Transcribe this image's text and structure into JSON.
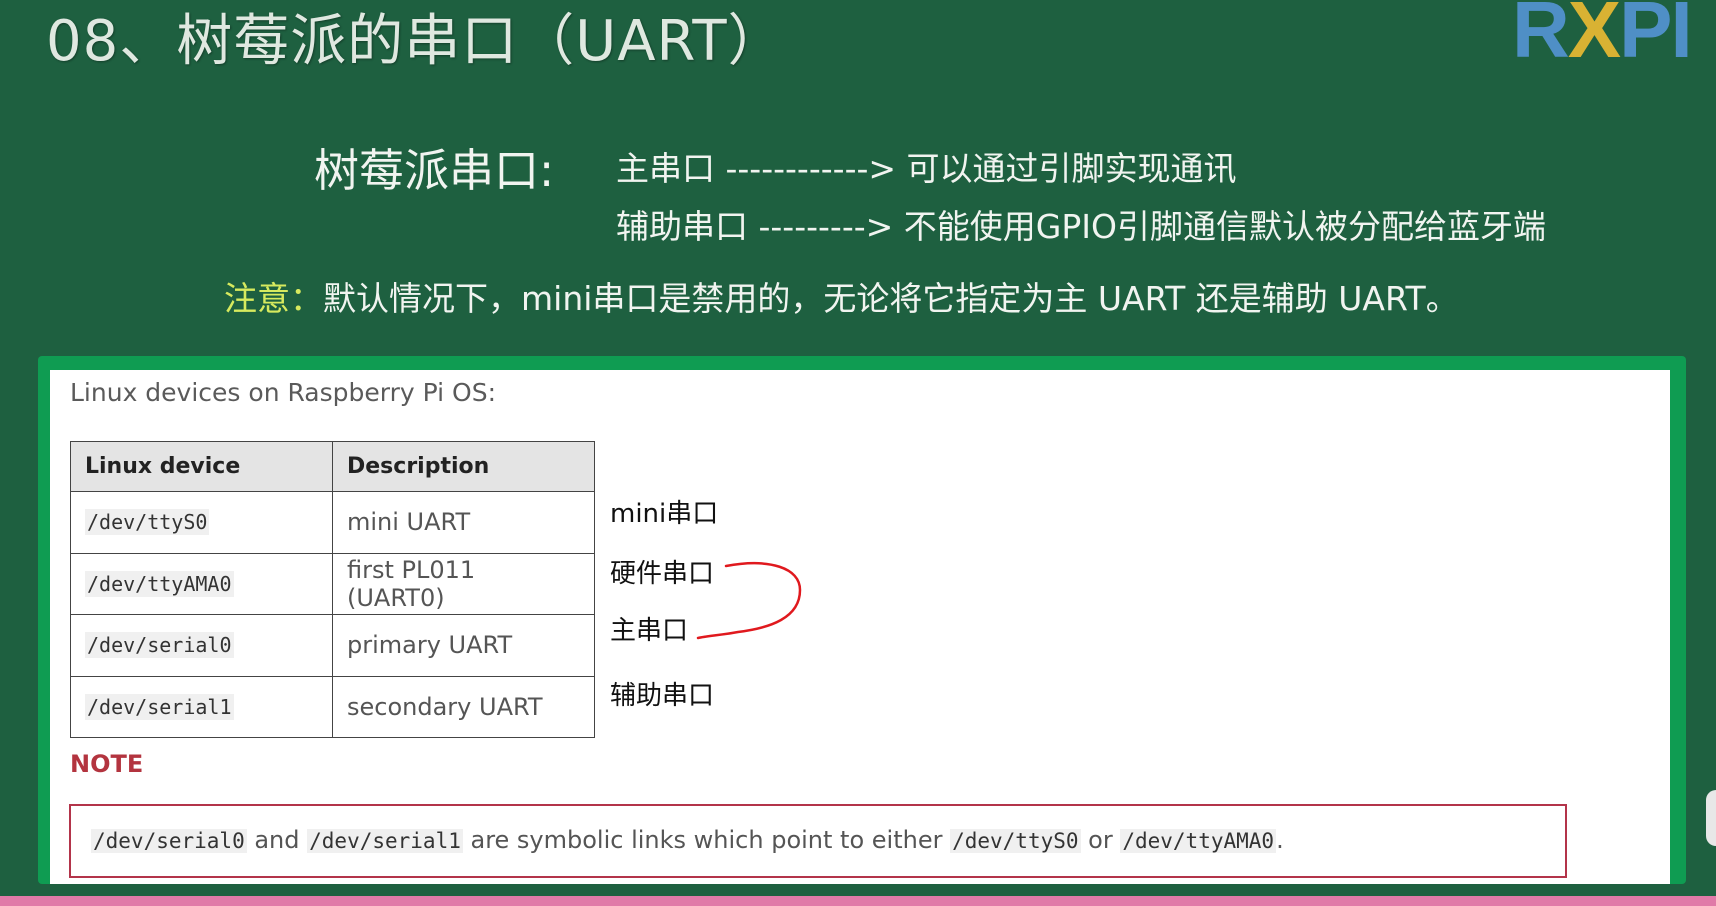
{
  "slide": {
    "title": "08、树莓派的串口（UART）",
    "logo": {
      "r": "R",
      "x": "X",
      "p": "PI"
    }
  },
  "intro": {
    "heading": "树莓派串口:",
    "rows": [
      "主串口 ------------> 可以通过引脚实现通讯",
      "辅助串口 ---------> 不能使用GPIO引脚通信默认被分配给蓝牙端"
    ],
    "note_key": "注意：",
    "note_text": "默认情况下，mini串口是禁用的，无论将它指定为主 UART 还是辅助 UART。"
  },
  "doc": {
    "intro": "Linux devices on Raspberry Pi OS:",
    "table": {
      "headers": [
        "Linux device",
        "Description"
      ],
      "rows": [
        {
          "device": "/dev/ttyS0",
          "description": "mini UART",
          "annotation": "mini串口"
        },
        {
          "device": "/dev/ttyAMA0",
          "description": "first PL011 (UART0)",
          "annotation": "硬件串口"
        },
        {
          "device": "/dev/serial0",
          "description": "primary UART",
          "annotation": "主串口"
        },
        {
          "device": "/dev/serial1",
          "description": "secondary UART",
          "annotation": "辅助串口"
        }
      ]
    },
    "note_label": "NOTE",
    "note": {
      "code1": "/dev/serial0",
      "t1": " and ",
      "code2": "/dev/serial1",
      "t2": " are symbolic links which point to either ",
      "code3": "/dev/ttyS0",
      "t3": " or ",
      "code4": "/dev/ttyAMA0",
      "t4": "."
    }
  },
  "colors": {
    "background": "#1e6040",
    "panel_border": "#0f9c52",
    "note_accent": "#b3343f",
    "highlight_key": "#d7ea5e",
    "annotation_bracket": "#e0191e"
  }
}
